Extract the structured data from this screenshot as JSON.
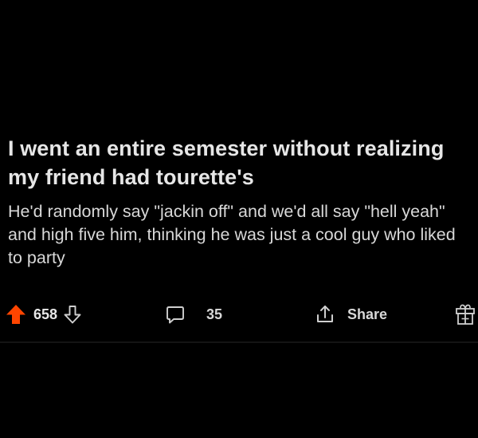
{
  "post": {
    "title": "I went an entire semester without realizing my friend had tourette's",
    "body": "He'd randomly say \"jackin off\" and we'd all say \"hell yeah\" and high five him, thinking he was just a cool guy who liked to party"
  },
  "actions": {
    "upvote_count": "658",
    "comment_count": "35",
    "share_label": "Share"
  },
  "icons": {
    "upvote": "upvote-arrow-icon",
    "downvote": "downvote-arrow-icon",
    "comment": "comment-bubble-icon",
    "share": "share-arrow-icon",
    "award": "gift-award-icon"
  },
  "colors": {
    "background": "#000000",
    "upvote_active": "#ff4500",
    "text": "#dcdcdc"
  }
}
